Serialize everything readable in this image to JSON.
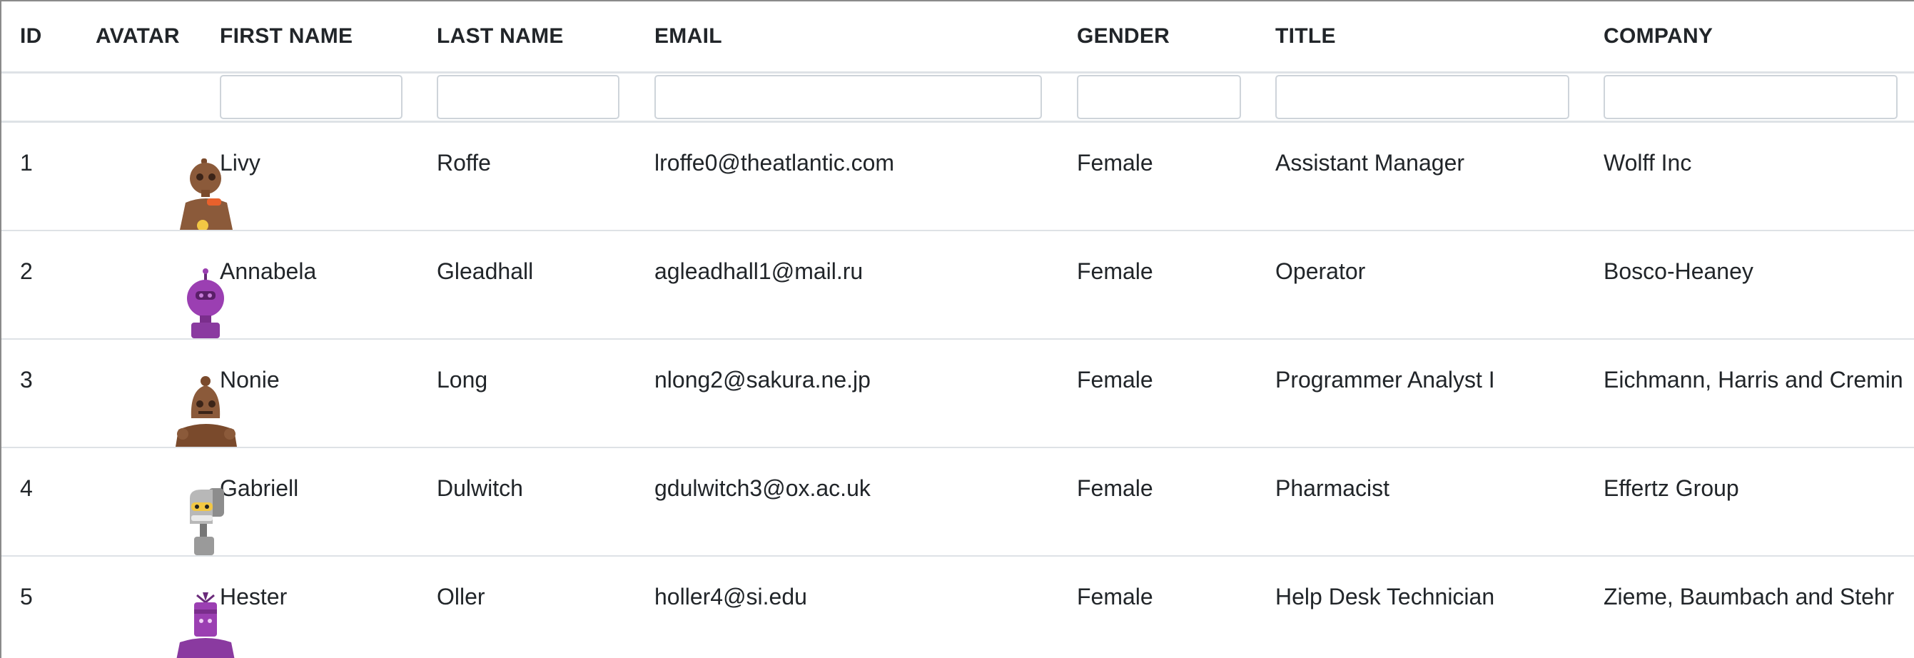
{
  "table": {
    "headers": {
      "id": "ID",
      "avatar": "AVATAR",
      "first_name": "FIRST NAME",
      "last_name": "LAST NAME",
      "email": "EMAIL",
      "gender": "GENDER",
      "title": "TITLE",
      "company": "COMPANY"
    },
    "filters": {
      "first_name": "",
      "last_name": "",
      "email": "",
      "gender": "",
      "title": "",
      "company": ""
    },
    "rows": [
      {
        "id": "1",
        "avatar_icon": "robot-avatar-brown-icon",
        "first_name": "Livy",
        "last_name": "Roffe",
        "email": "lroffe0@theatlantic.com",
        "gender": "Female",
        "title": "Assistant Manager",
        "company": "Wolff Inc"
      },
      {
        "id": "2",
        "avatar_icon": "robot-avatar-purple-icon",
        "first_name": "Annabela",
        "last_name": "Gleadhall",
        "email": "agleadhall1@mail.ru",
        "gender": "Female",
        "title": "Operator",
        "company": "Bosco-Heaney"
      },
      {
        "id": "3",
        "avatar_icon": "robot-avatar-brown-icon",
        "first_name": "Nonie",
        "last_name": "Long",
        "email": "nlong2@sakura.ne.jp",
        "gender": "Female",
        "title": "Programmer Analyst I",
        "company": "Eichmann, Harris and Cremin"
      },
      {
        "id": "4",
        "avatar_icon": "robot-avatar-gray-icon",
        "first_name": "Gabriell",
        "last_name": "Dulwitch",
        "email": "gdulwitch3@ox.ac.uk",
        "gender": "Female",
        "title": "Pharmacist",
        "company": "Effertz Group"
      },
      {
        "id": "5",
        "avatar_icon": "robot-avatar-purple-icon",
        "first_name": "Hester",
        "last_name": "Oller",
        "email": "holler4@si.edu",
        "gender": "Female",
        "title": "Help Desk Technician",
        "company": "Zieme, Baumbach and Stehr"
      }
    ]
  },
  "colors": {
    "border": "#dee2e6",
    "input_border": "#ced4da",
    "text": "#212529"
  }
}
